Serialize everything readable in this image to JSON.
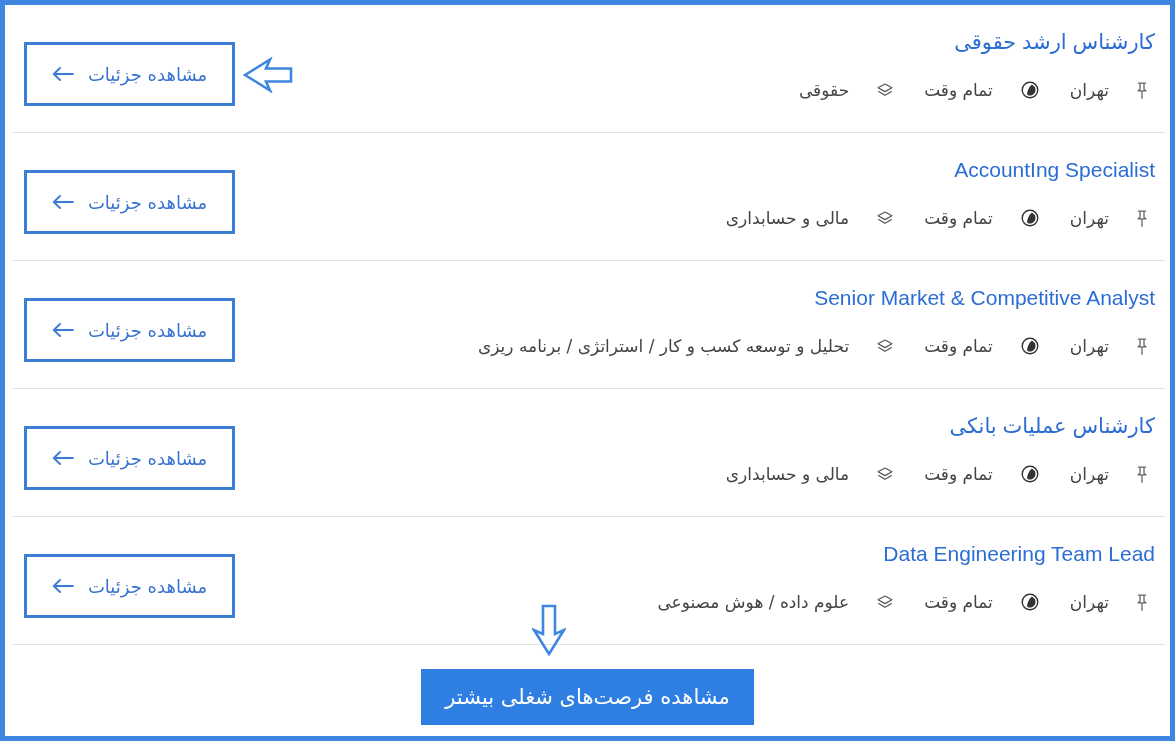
{
  "jobs": [
    {
      "title": "کارشناس ارشد حقوقی",
      "location": "تهران",
      "schedule": "تمام وقت",
      "category": "حقوقی",
      "button": "مشاهده جزئیات",
      "pointed": true
    },
    {
      "title": "AccountIng Specialist",
      "location": "تهران",
      "schedule": "تمام وقت",
      "category": "مالی و حسابداری",
      "button": "مشاهده جزئیات",
      "pointed": false
    },
    {
      "title": "Senior Market & Competitive Analyst",
      "location": "تهران",
      "schedule": "تمام وقت",
      "category": "تحلیل و توسعه کسب و کار / استراتژی / برنامه ریزی",
      "button": "مشاهده جزئیات",
      "pointed": false
    },
    {
      "title": "کارشناس عملیات بانکی",
      "location": "تهران",
      "schedule": "تمام وقت",
      "category": "مالی و حسابداری",
      "button": "مشاهده جزئیات",
      "pointed": false
    },
    {
      "title": "Data Engineering Team Lead",
      "location": "تهران",
      "schedule": "تمام وقت",
      "category": "علوم داده / هوش مصنوعی",
      "button": "مشاهده جزئیات",
      "pointed": false
    }
  ],
  "more_button": {
    "label": "مشاهده فرصت‌های شغلی بیشتر",
    "pointed": true
  }
}
